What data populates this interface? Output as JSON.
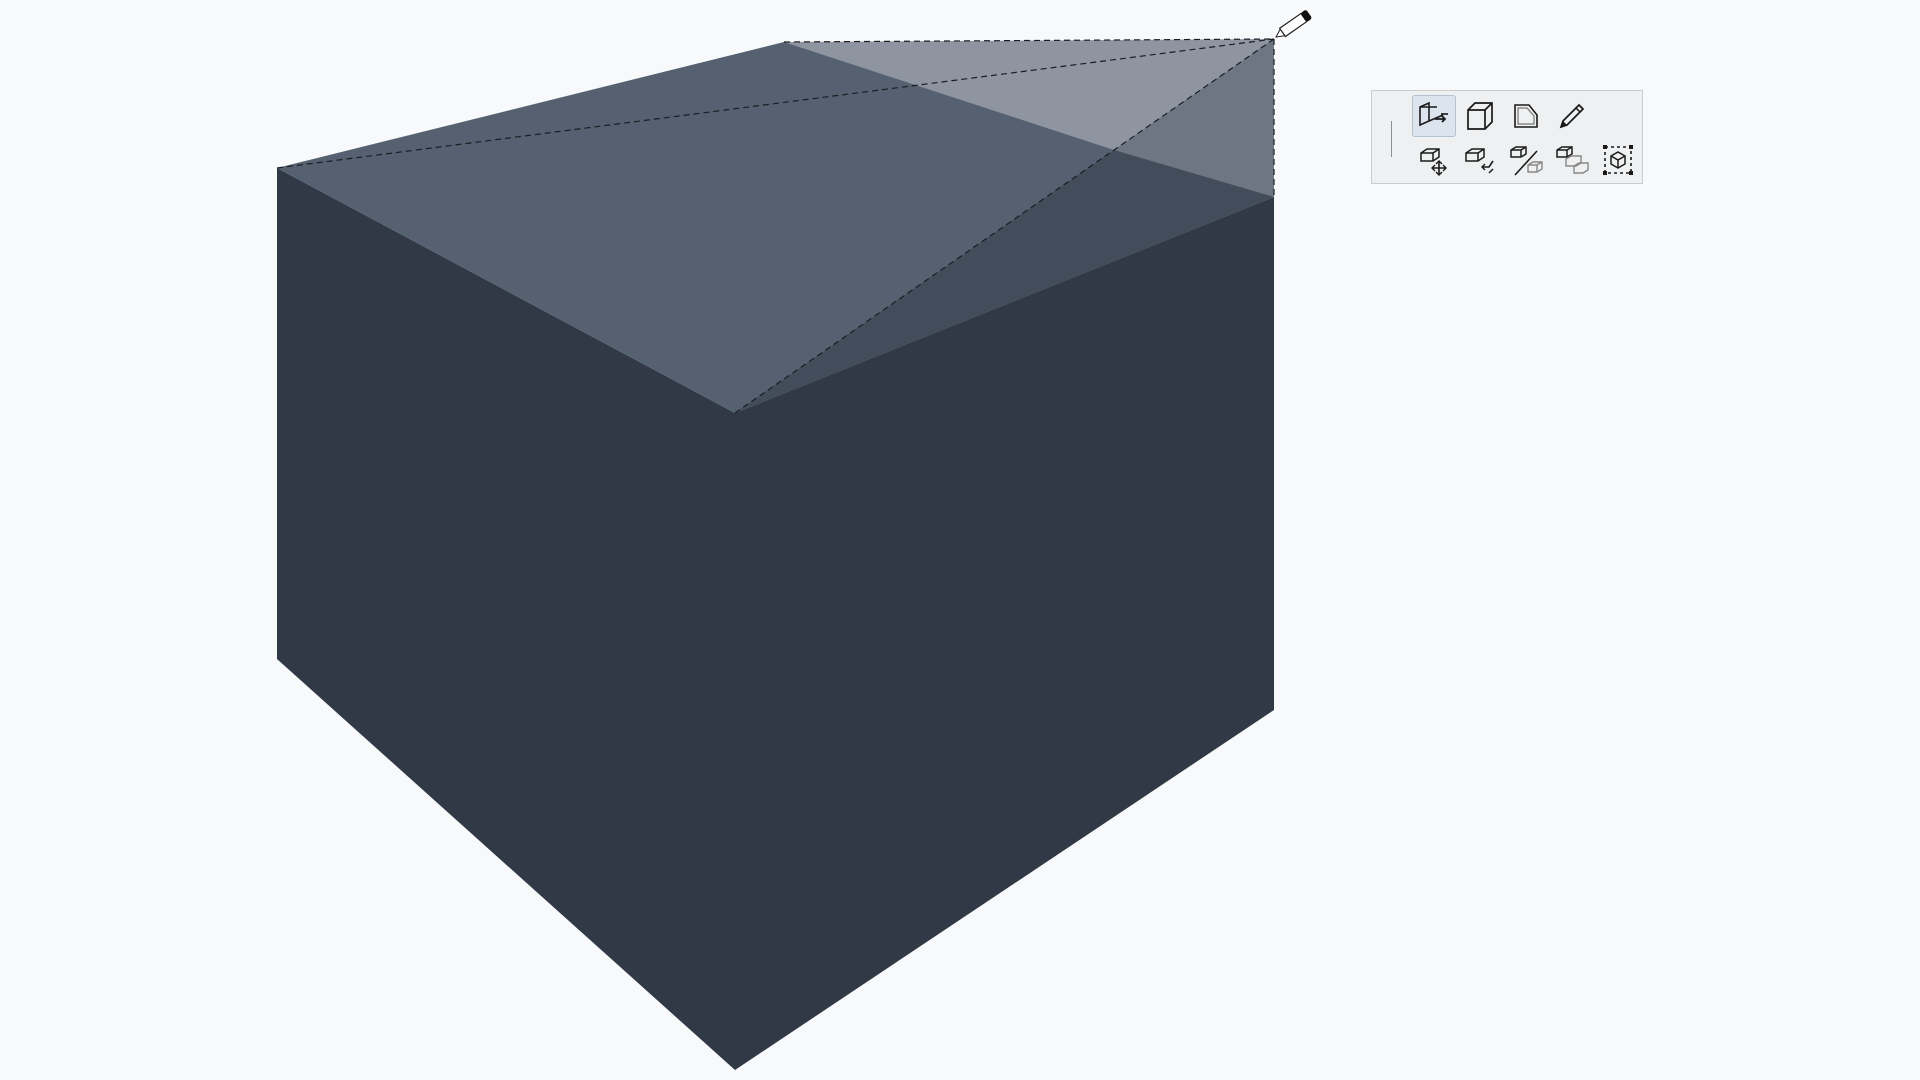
{
  "viewport": {
    "background": "#f7f9fb",
    "object": "box",
    "colors": {
      "front_faces": "#313846",
      "top_face": "#556170",
      "top_face_selected": "#8e95a1",
      "top_face_shadow": "#424c5a",
      "top_right_shade": "#6e7684",
      "guide_line": "#1a1d22"
    },
    "cursor": "pencil-cursor"
  },
  "toolbar": {
    "background": "#eef0f2",
    "active_tool": "push-pull-tool",
    "tools": [
      {
        "name": "push-pull-tool",
        "icon": "push-pull-icon",
        "active": true
      },
      {
        "name": "solid-box-tool",
        "icon": "box-icon",
        "active": false
      },
      {
        "name": "shape-edit-tool",
        "icon": "face-chamfer-icon",
        "active": false
      },
      {
        "name": "pencil-tool",
        "icon": "pencil-icon",
        "active": false
      },
      {
        "name": "move-tool",
        "icon": "move-object-icon",
        "active": false
      },
      {
        "name": "rotate-tool",
        "icon": "rotate-object-icon",
        "active": false
      },
      {
        "name": "mirror-tool",
        "icon": "mirror-object-icon",
        "active": false
      },
      {
        "name": "copy-tool",
        "icon": "copy-array-icon",
        "active": false
      },
      {
        "name": "bounding-box-tool",
        "icon": "bounding-box-icon",
        "active": false
      }
    ]
  }
}
